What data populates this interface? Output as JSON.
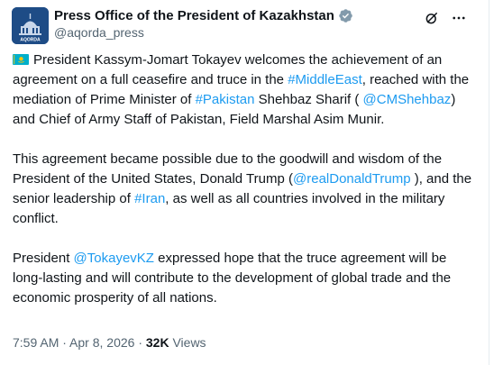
{
  "header": {
    "display_name": "Press Office of the President of Kazakhstan",
    "handle": "@aqorda_press",
    "avatar_caption": "AQORDA"
  },
  "icons": {
    "verified": "verified-badge-icon",
    "grok": "grok-icon",
    "more": "more-icon",
    "flag": "kazakhstan-flag-icon"
  },
  "colors": {
    "link": "#1d9bf0",
    "text": "#0f1419",
    "muted": "#536471",
    "flag_blue": "#00afca",
    "flag_gold": "#fec50c"
  },
  "tweet": {
    "p1": {
      "t1": "President Kassym-Jomart Tokayev welcomes the achievement of an agreement on a full ceasefire and truce in the ",
      "tag_middleeast": "#MiddleEast",
      "t2": ", reached with the mediation of Prime Minister of ",
      "tag_pakistan": "#Pakistan",
      "t3": " Shehbaz Sharif ( ",
      "mention_cmshehbaz": "@CMShehbaz",
      "t4": ") and Chief of Army Staff of Pakistan, Field Marshal Asim Munir."
    },
    "p2": {
      "t1": "This agreement became possible due to the goodwill and wisdom of the President of the United States, Donald Trump (",
      "mention_realdonaldtrump": "@realDonaldTrump",
      "t2": " ), and the senior leadership of ",
      "tag_iran": "#Iran",
      "t3": ", as well as all countries involved in the military conflict."
    },
    "p3": {
      "t1": "President ",
      "mention_tokayevkz": "@TokayevKZ",
      "t2": " expressed hope that the truce agreement will be long-lasting and will contribute to the development of global trade and the economic prosperity of all nations."
    }
  },
  "meta": {
    "time": "7:59 AM",
    "separator1": " · ",
    "date": "Apr 8, 2026",
    "separator2": " · ",
    "views_count": "32K",
    "views_label": " Views"
  }
}
